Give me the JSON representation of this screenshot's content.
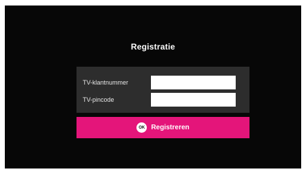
{
  "dialog": {
    "title": "Registratie"
  },
  "form": {
    "customer_number_label": "TV-klantnummer",
    "customer_number_value": "",
    "pincode_label": "TV-pincode",
    "pincode_value": ""
  },
  "register_button": {
    "ok_icon_text": "OK",
    "label": "Registreren"
  },
  "colors": {
    "accent": "#e4157a",
    "background": "#070707",
    "panel": "#2d2d2d"
  }
}
